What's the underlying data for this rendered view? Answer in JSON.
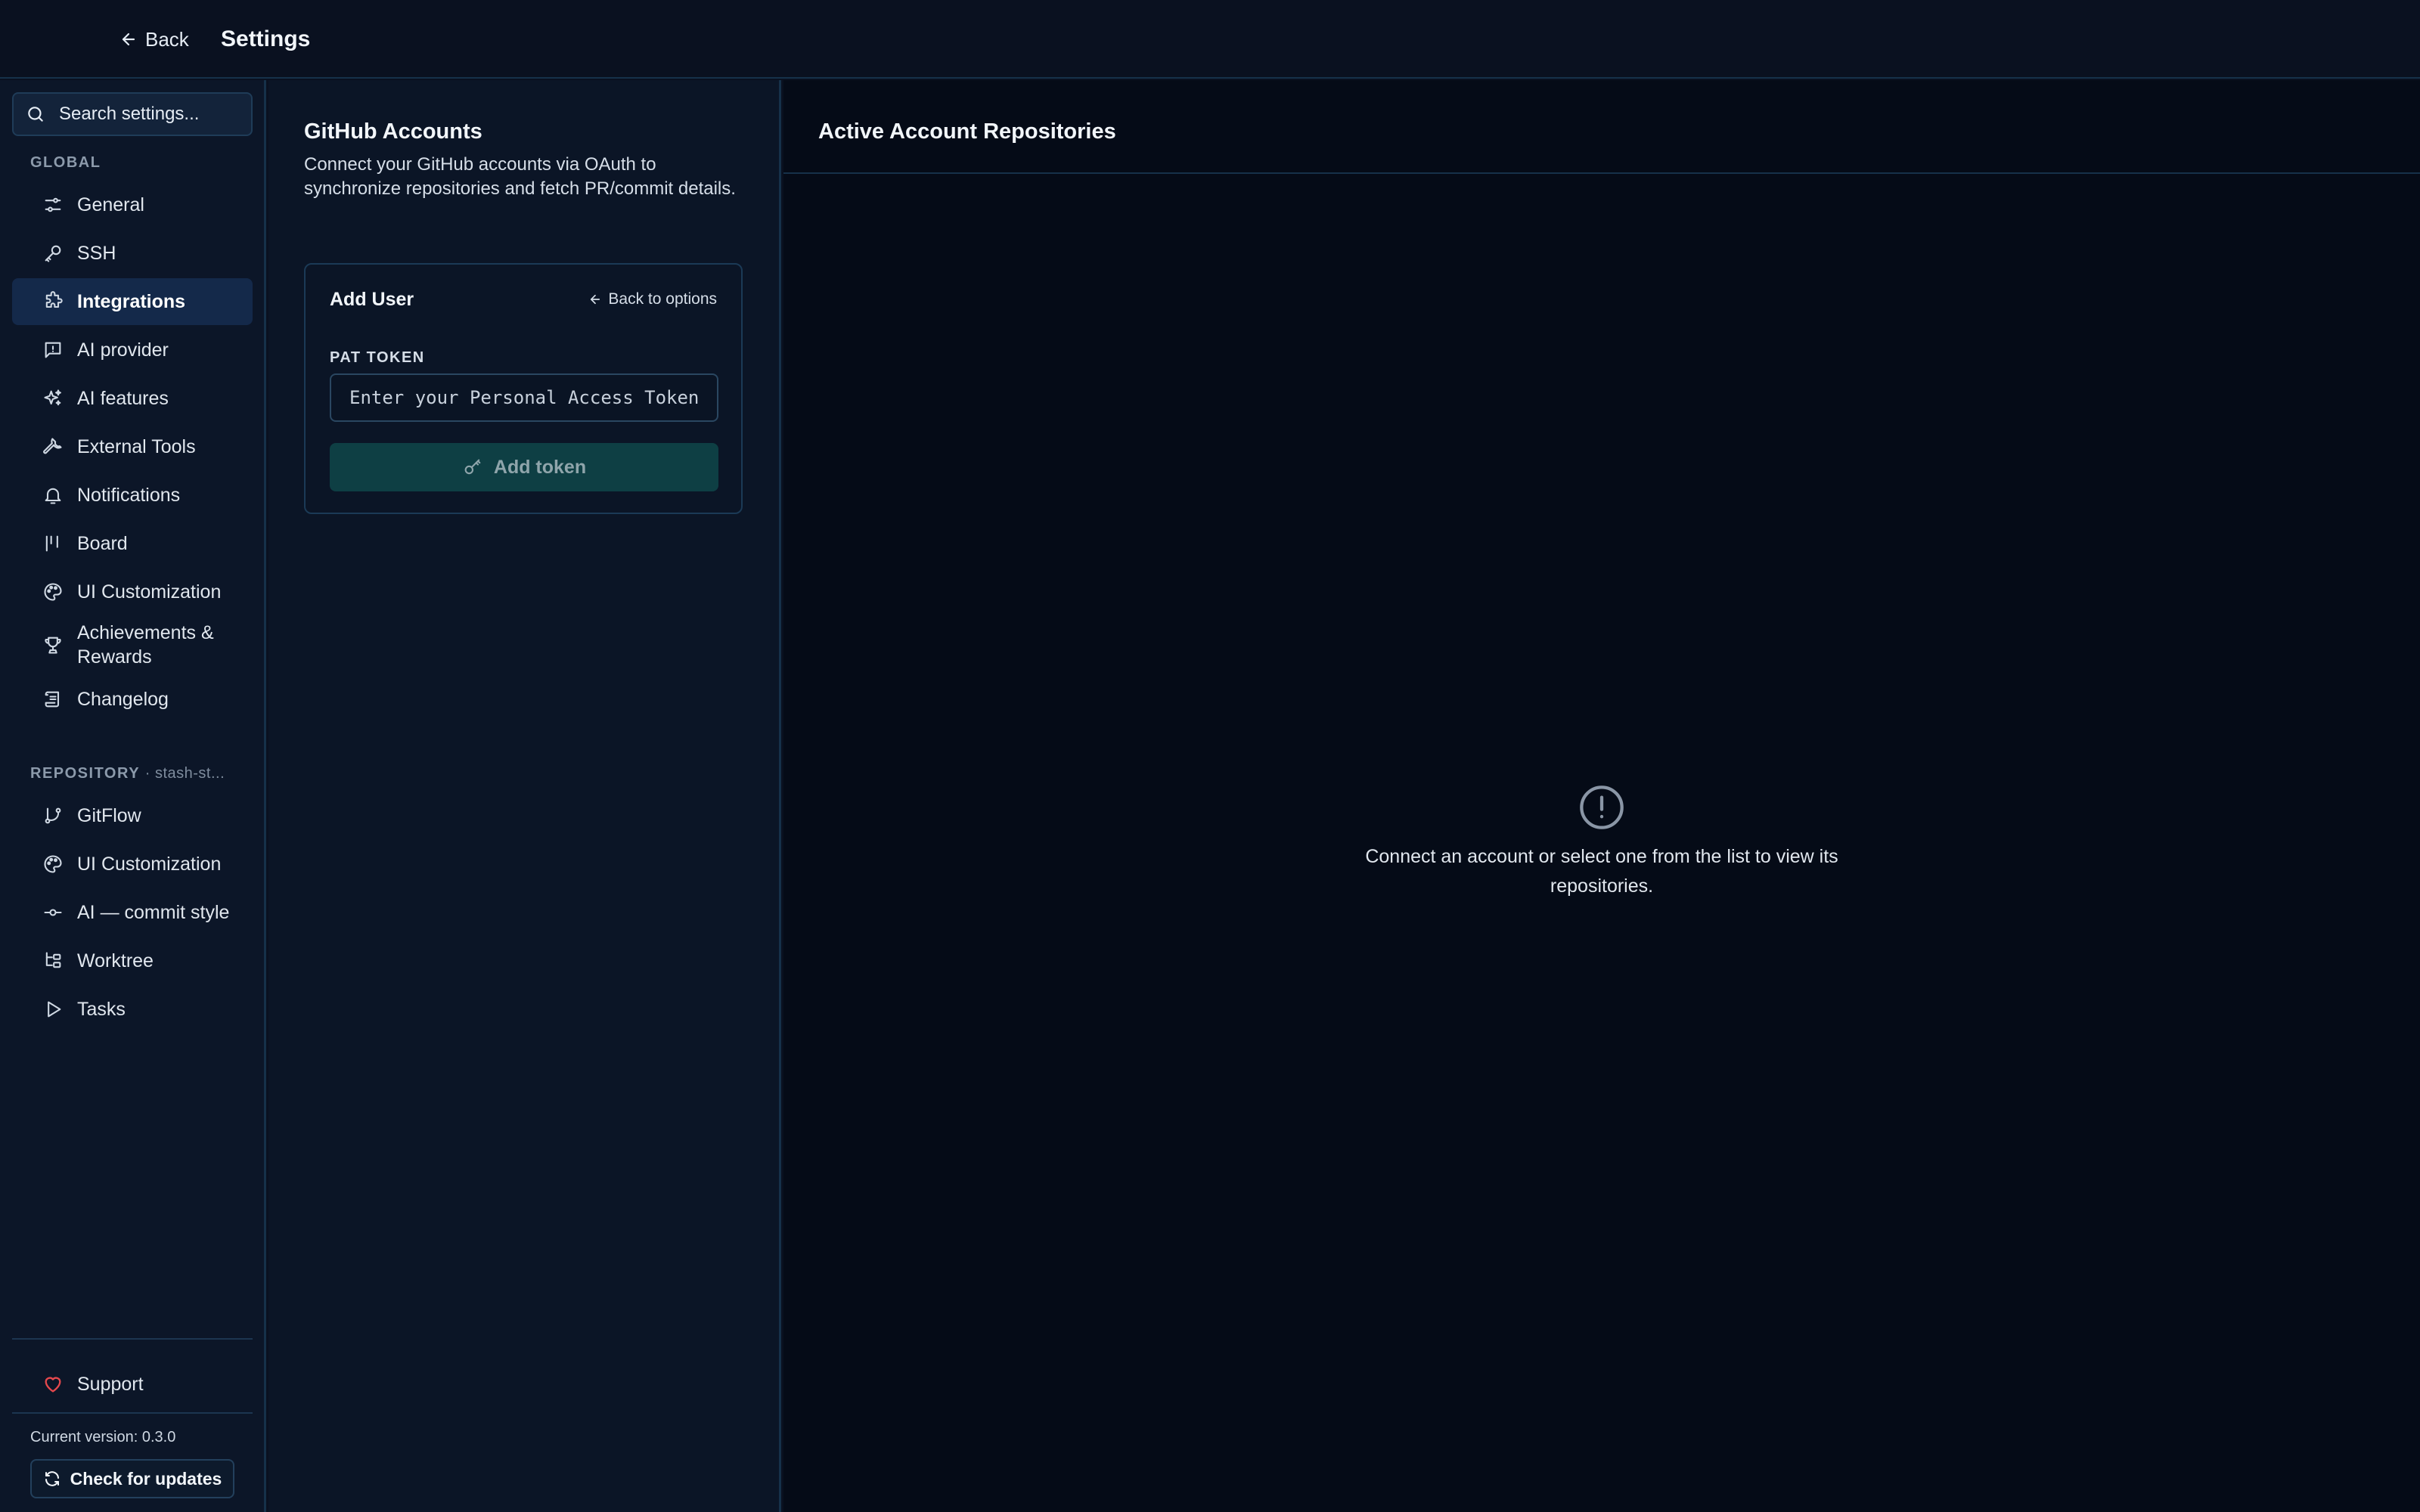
{
  "header": {
    "back_label": "Back",
    "title": "Settings"
  },
  "sidebar": {
    "search_placeholder": "Search settings...",
    "global_label": "GLOBAL",
    "global_items": [
      {
        "label": "General",
        "icon": "sliders-icon"
      },
      {
        "label": "SSH",
        "icon": "key-icon"
      },
      {
        "label": "Integrations",
        "icon": "puzzle-icon",
        "active": true
      },
      {
        "label": "AI provider",
        "icon": "message-icon"
      },
      {
        "label": "AI features",
        "icon": "sparkles-icon"
      },
      {
        "label": "External Tools",
        "icon": "wrench-icon"
      },
      {
        "label": "Notifications",
        "icon": "bell-icon"
      },
      {
        "label": "Board",
        "icon": "board-icon"
      },
      {
        "label": "UI Customization",
        "icon": "palette-icon"
      },
      {
        "label": "Achievements & Rewards",
        "icon": "trophy-icon"
      },
      {
        "label": "Changelog",
        "icon": "scroll-icon"
      }
    ],
    "repository_label": "REPOSITORY",
    "repository_name": "· stash-st...",
    "repository_items": [
      {
        "label": "GitFlow",
        "icon": "git-branch-icon"
      },
      {
        "label": "UI Customization",
        "icon": "palette-icon"
      },
      {
        "label": "AI — commit style",
        "icon": "git-commit-icon"
      },
      {
        "label": "Worktree",
        "icon": "worktree-icon"
      },
      {
        "label": "Tasks",
        "icon": "play-icon"
      }
    ],
    "support_label": "Support",
    "version_text": "Current version: 0.3.0",
    "check_updates_label": "Check for updates"
  },
  "accounts_panel": {
    "title": "GitHub Accounts",
    "description": "Connect your GitHub accounts via OAuth to synchronize repositories and fetch PR/commit details.",
    "card": {
      "title": "Add User",
      "back_to_options": "Back to options",
      "pat_label": "PAT TOKEN",
      "pat_placeholder": "Enter your Personal Access Token",
      "pat_value": "",
      "add_token_label": "Add token"
    }
  },
  "repos_panel": {
    "title": "Active Account Repositories",
    "empty_message": "Connect an account or select one from the list to view its repositories."
  },
  "colors": {
    "background": "#0a1120",
    "sidebar_active": "#14294a",
    "accent_button": "#0e3f44",
    "support_heart": "#e5484d"
  }
}
